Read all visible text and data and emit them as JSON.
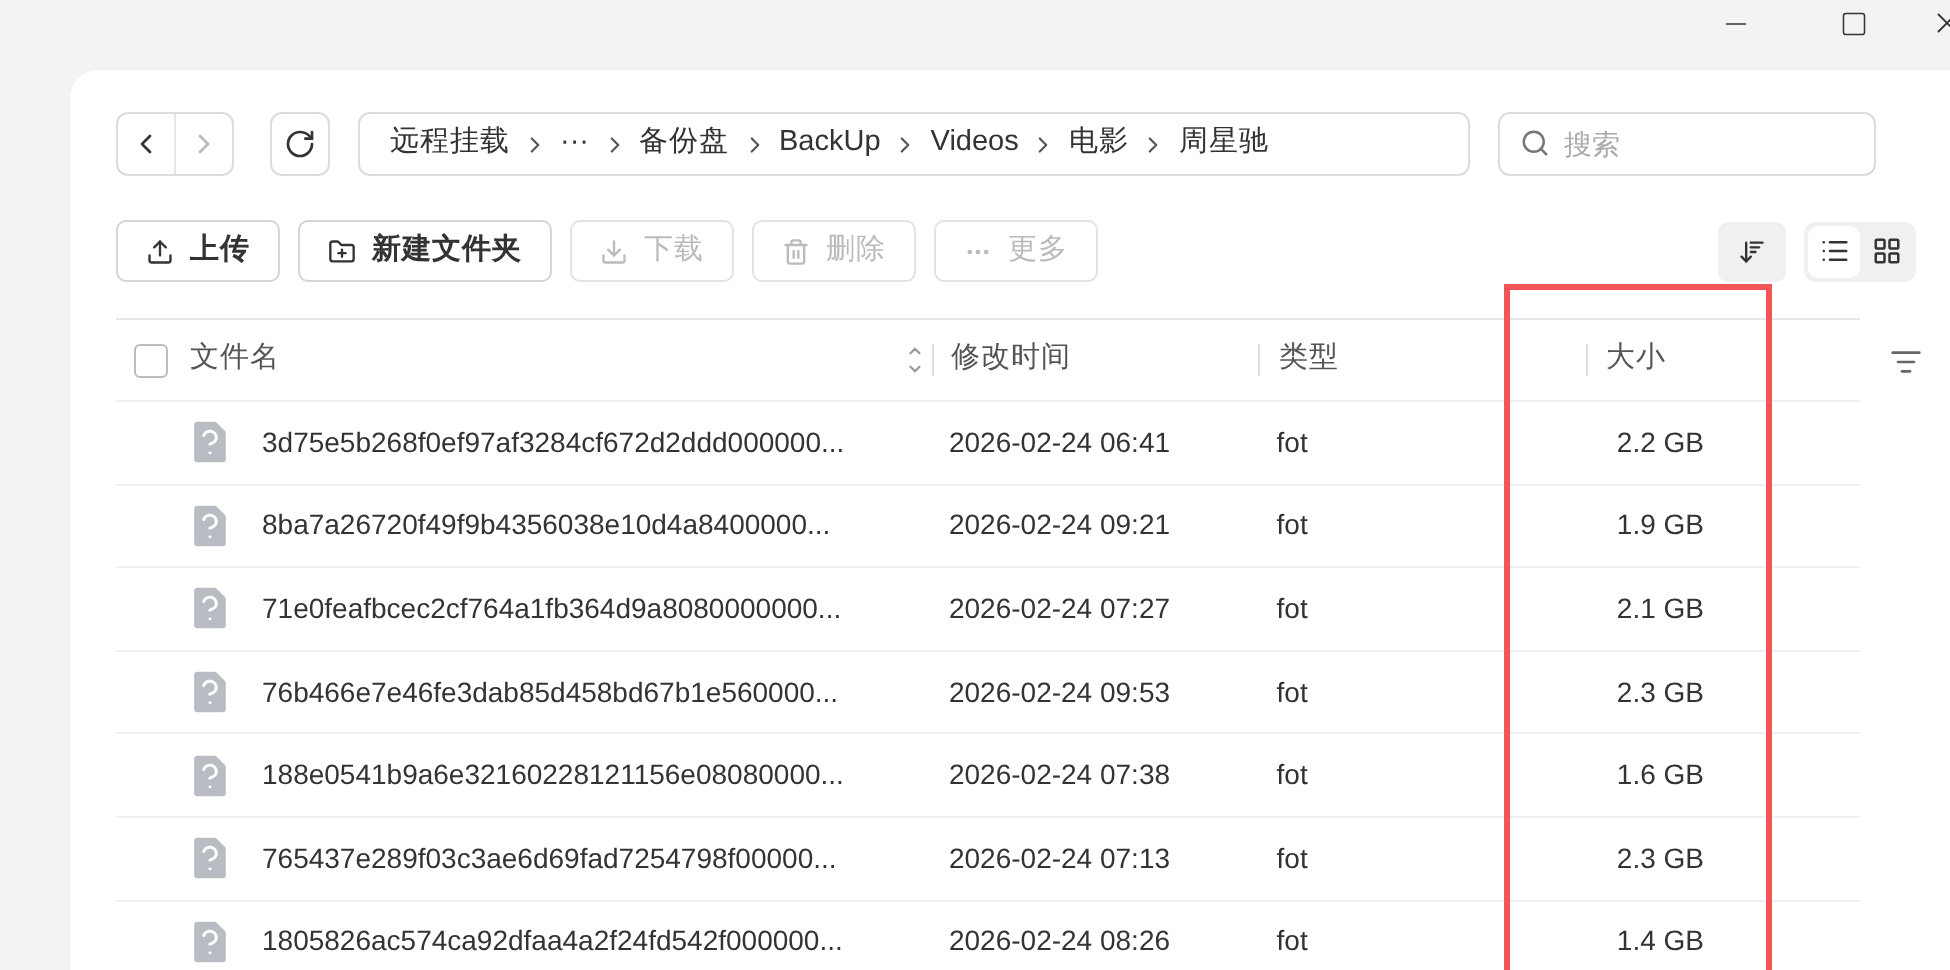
{
  "nav": {
    "back_disabled": false,
    "forward_disabled": true
  },
  "breadcrumb": [
    "远程挂载",
    "···",
    "备份盘",
    "BackUp",
    "Videos",
    "电影",
    "周星驰"
  ],
  "search": {
    "placeholder": "搜索"
  },
  "toolbar": [
    {
      "kind": "upload",
      "label": "上传",
      "disabled": false
    },
    {
      "kind": "new-folder",
      "label": "新建文件夹",
      "disabled": false
    },
    {
      "kind": "download",
      "label": "下载",
      "disabled": true
    },
    {
      "kind": "delete",
      "label": "删除",
      "disabled": true
    },
    {
      "kind": "more",
      "label": "更多",
      "disabled": true
    }
  ],
  "view_modes": [
    {
      "kind": "list",
      "selected": true
    },
    {
      "kind": "grid",
      "selected": false
    }
  ],
  "table": {
    "select_all": {
      "checked": false
    },
    "columns": [
      {
        "label": "文件名",
        "sortable": true,
        "highlighted": false
      },
      {
        "label": "修改时间",
        "sortable": false,
        "highlighted": false
      },
      {
        "label": "类型",
        "sortable": false,
        "highlighted": false
      },
      {
        "label": "大小",
        "sortable": false,
        "highlighted": true
      }
    ],
    "rows": [
      {
        "name": "3d75e5b268f0ef97af3284cf672d2ddd000000...",
        "modified": "2026-02-24 06:41",
        "type": "fot",
        "size": "2.2 GB"
      },
      {
        "name": "8ba7a26720f49f9b4356038e10d4a8400000...",
        "modified": "2026-02-24 09:21",
        "type": "fot",
        "size": "1.9 GB"
      },
      {
        "name": "71e0feafbcec2cf764a1fb364d9a8080000000...",
        "modified": "2026-02-24 07:27",
        "type": "fot",
        "size": "2.1 GB"
      },
      {
        "name": "76b466e7e46fe3dab85d458bd67b1e560000...",
        "modified": "2026-02-24 09:53",
        "type": "fot",
        "size": "2.3 GB"
      },
      {
        "name": "188e0541b9a6e32160228121156e08080000...",
        "modified": "2026-02-24 07:38",
        "type": "fot",
        "size": "1.6 GB"
      },
      {
        "name": "765437e289f03c3ae6d69fad7254798f00000...",
        "modified": "2026-02-24 07:13",
        "type": "fot",
        "size": "2.3 GB"
      },
      {
        "name": "1805826ac574ca92dfaa4a2f24fd542f000000...",
        "modified": "2026-02-24 08:26",
        "type": "fot",
        "size": "1.4 GB"
      }
    ]
  }
}
